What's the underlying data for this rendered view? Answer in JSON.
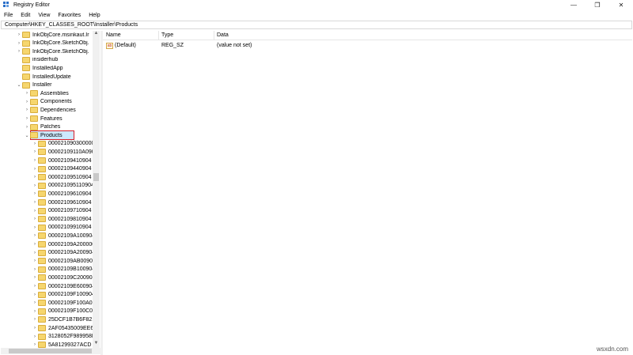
{
  "window": {
    "title": "Registry Editor",
    "controls": {
      "minimize": "—",
      "maximize": "❐",
      "close": "✕"
    }
  },
  "menu": [
    "File",
    "Edit",
    "View",
    "Favorites",
    "Help"
  ],
  "address": "Computer\\HKEY_CLASSES_ROOT\\Installer\\Products",
  "tree": [
    "InkObjCore.msinkaut.Ir",
    "InkObjCore.SketchObj.",
    "InkObjCore.SketchObj.",
    "insiderhub",
    "InstalledApp",
    "InstalledUpdate",
    "Installer",
    "Assemblies",
    "Components",
    "Dependencies",
    "Features",
    "Patches",
    "Products",
    "00002109030000000",
    "00002109110A0904",
    "00002109410904",
    "00002109440904",
    "00002109510904",
    "000021095110904",
    "00002109610904",
    "00002109610904",
    "00002109710904",
    "00002109810904",
    "00002109910904",
    "00002109A100904",
    "00002109A200000",
    "00002109A200904",
    "00002109AB00904",
    "00002109B100904",
    "00002109C200904",
    "00002109E600904",
    "00002109F100904",
    "00002109F100A0C",
    "00002109F100C04",
    "25DCF1B7B6F821",
    "2AF05435009EE65",
    "3128052F989958E",
    "5A81299327ACD"
  ],
  "list": {
    "columns": [
      "Name",
      "Type",
      "Data"
    ],
    "rows": [
      {
        "name": "(Default)",
        "type": "REG_SZ",
        "data": "(value not set)",
        "icon": "ab-string-icon"
      }
    ]
  },
  "watermark": "wsxdn.com",
  "colors": {
    "selection_outline": "#d51f2b",
    "folder": "#f6d66e"
  }
}
